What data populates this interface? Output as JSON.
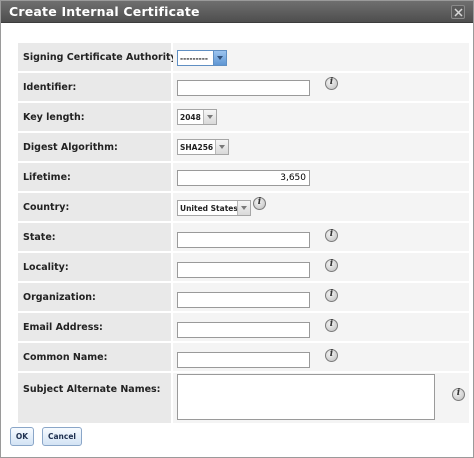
{
  "dialog": {
    "title": "Create Internal Certificate",
    "close_icon": "close-x-icon"
  },
  "fields": {
    "signing_ca": {
      "label": "Signing Certificate Authority:",
      "value": "---------"
    },
    "identifier": {
      "label": "Identifier:",
      "value": ""
    },
    "key_length": {
      "label": "Key length:",
      "value": "2048"
    },
    "digest_algorithm": {
      "label": "Digest Algorithm:",
      "value": "SHA256"
    },
    "lifetime": {
      "label": "Lifetime:",
      "value": "3,650"
    },
    "country": {
      "label": "Country:",
      "value": "United States"
    },
    "state": {
      "label": "State:",
      "value": ""
    },
    "locality": {
      "label": "Locality:",
      "value": ""
    },
    "organization": {
      "label": "Organization:",
      "value": ""
    },
    "email_address": {
      "label": "Email Address:",
      "value": ""
    },
    "common_name": {
      "label": "Common Name:",
      "value": ""
    },
    "subject_alternate_names": {
      "label": "Subject Alternate Names:",
      "value": ""
    }
  },
  "buttons": {
    "ok": "OK",
    "cancel": "Cancel"
  },
  "icons": {
    "help": "info-icon",
    "dropdown": "chevron-down-icon"
  },
  "colors": {
    "titlebar": "#5a5a5a",
    "label_bg": "#e9e9e9",
    "value_bg": "#f4f4f4",
    "button_border": "#8aa6c8"
  }
}
